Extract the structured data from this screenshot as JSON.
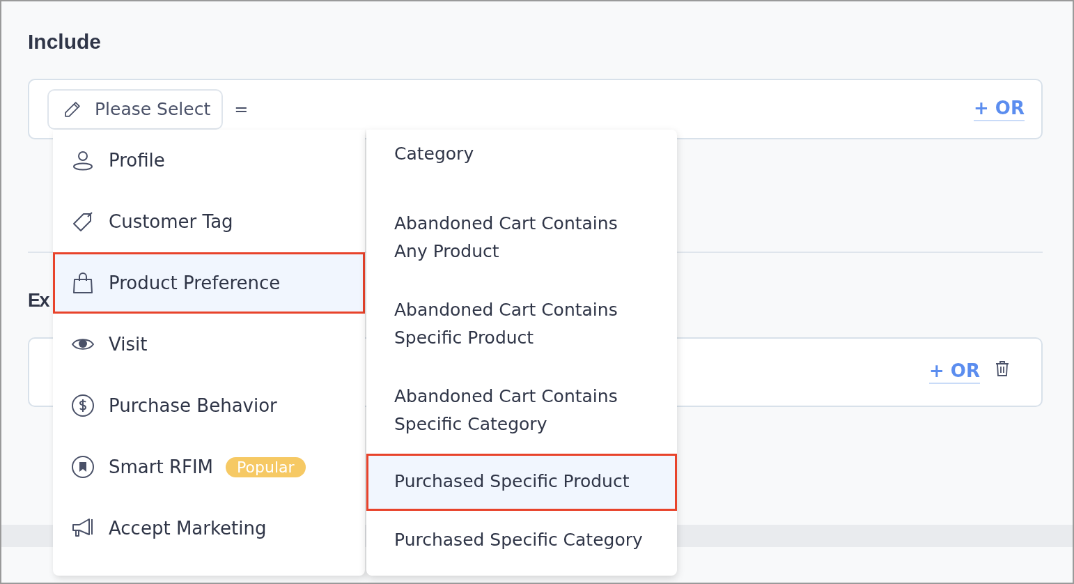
{
  "include": {
    "title": "Include",
    "field": {
      "label": "Please Select",
      "operator": "="
    },
    "or_link": "+ OR"
  },
  "exclude": {
    "title": "Ex",
    "or_link": "+ OR"
  },
  "menu": {
    "categories": [
      {
        "kind": "profile",
        "label": "Profile",
        "selected": false
      },
      {
        "kind": "tag",
        "label": "Customer Tag",
        "selected": false
      },
      {
        "kind": "bag",
        "label": "Product Preference",
        "selected": true
      },
      {
        "kind": "eye",
        "label": "Visit",
        "selected": false
      },
      {
        "kind": "dollar",
        "label": "Purchase Behavior",
        "selected": false
      },
      {
        "kind": "bookmark",
        "label": "Smart RFIM",
        "badge": "Popular",
        "selected": false
      },
      {
        "kind": "megaphone",
        "label": "Accept Marketing",
        "selected": false
      }
    ],
    "options": [
      {
        "label": "Category",
        "selected": false
      },
      {
        "label": "Abandoned Cart Contains Any Product",
        "selected": false
      },
      {
        "label": "Abandoned Cart Contains Specific Product",
        "selected": false
      },
      {
        "label": "Abandoned Cart Contains Specific Category",
        "selected": false
      },
      {
        "label": "Purchased Specific Product",
        "selected": true
      },
      {
        "label": "Purchased Specific Category",
        "selected": false
      }
    ]
  }
}
